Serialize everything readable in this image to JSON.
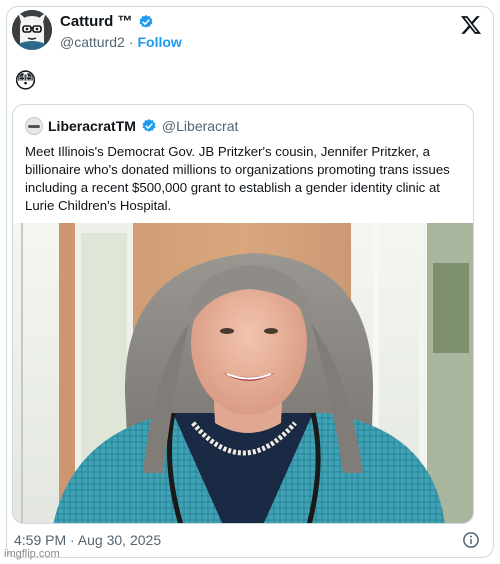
{
  "author": {
    "display_name": "Catturd ™",
    "handle": "@catturd2",
    "separator": "·",
    "follow_label": "Follow",
    "verified_icon": "verified-badge-icon",
    "verified_color": "#1d9bf0"
  },
  "post": {
    "emoji": "😳",
    "timestamp": "4:59 PM · Aug 30, 2025"
  },
  "quoted": {
    "display_name": "LiberacratTM",
    "handle": "@Liberacrat",
    "text": "Meet Illinois's Democrat Gov. JB Pritzker's cousin, Jennifer Pritzker, a billionaire who's donated millions to organizations promoting trans issues including a recent $500,000 grant to establish a gender identity clinic at Lurie Children's Hospital."
  },
  "icons": {
    "x_logo": "x-logo-icon",
    "info": "info-icon"
  },
  "watermark": "imgflip.com",
  "colors": {
    "link": "#1d9bf0",
    "secondary_text": "#536471",
    "border": "#cfd9de"
  }
}
